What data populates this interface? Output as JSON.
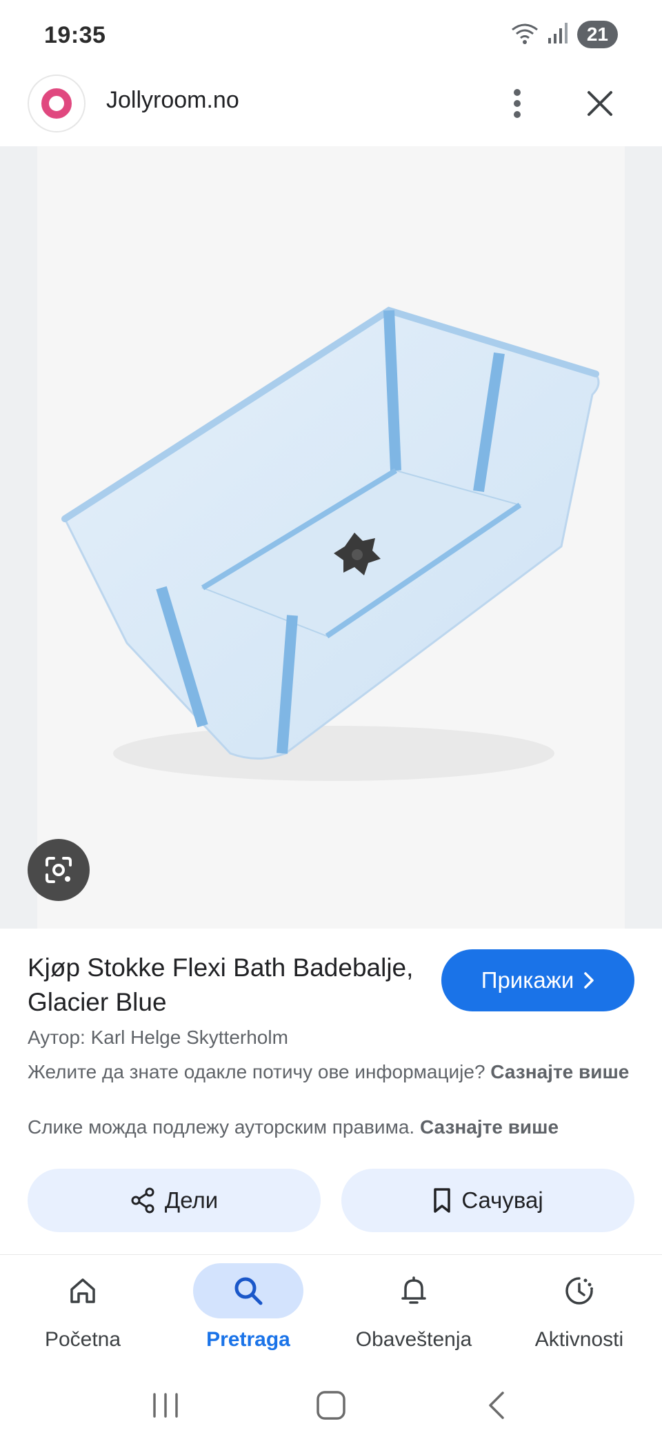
{
  "status_bar": {
    "time": "19:35",
    "battery": "21",
    "icons": [
      "wifi-icon",
      "signal-icon"
    ]
  },
  "header": {
    "site_name": "Jollyroom.no",
    "logo_color": "#e0487f"
  },
  "image": {
    "subject": "bathtub-image"
  },
  "product": {
    "title": "Kjøp Stokke Flexi Bath Badebalje, Glacier Blue",
    "show_label": "Прикажи",
    "author": "Аутор: Karl Helge Skytterholm",
    "info_question": "Желите да знате одакле потичу ове информације?",
    "learn_more_1": "Сазнајте више",
    "copyright_text": "Слике можда подлежу ауторским правима.",
    "learn_more_2": "Сазнајте више"
  },
  "actions": {
    "share_label": "Дели",
    "save_label": "Сачувај"
  },
  "nav": {
    "items": [
      {
        "label": "Početna",
        "icon": "home-icon"
      },
      {
        "label": "Pretraga",
        "icon": "search-icon"
      },
      {
        "label": "Obaveštenja",
        "icon": "bell-icon"
      },
      {
        "label": "Aktivnosti",
        "icon": "activity-icon"
      }
    ]
  },
  "colors": {
    "accent": "#1a73e8",
    "action_bg": "#e8f0fe",
    "active_pill": "#d3e3fd"
  }
}
